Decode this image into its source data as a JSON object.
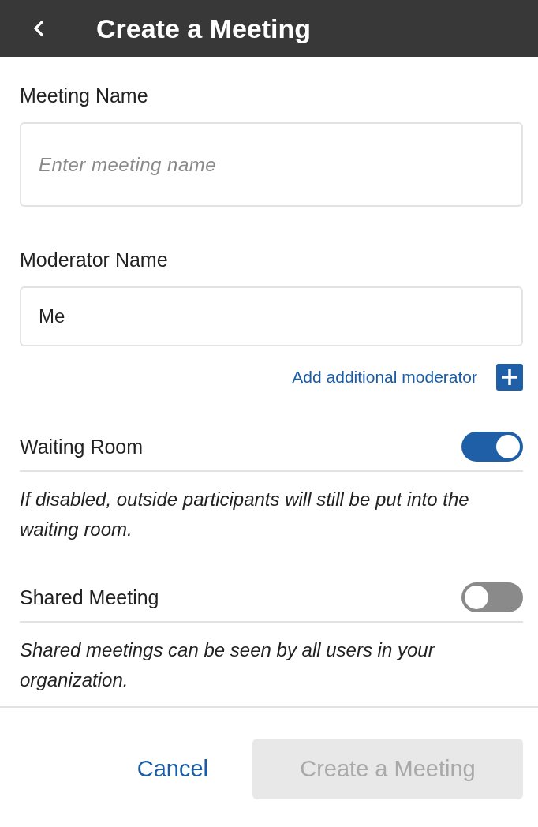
{
  "header": {
    "title": "Create a Meeting"
  },
  "fields": [
    {
      "label": "Meeting Name",
      "placeholder": "Enter meeting name"
    },
    {
      "label": "Moderator Name",
      "value": "Me"
    }
  ],
  "add_moderator": {
    "label": "Add additional moderator"
  },
  "toggles": [
    {
      "label": "Waiting Room",
      "on": true,
      "description": "If disabled, outside participants will still be put into the waiting room."
    },
    {
      "label": "Shared Meeting",
      "on": false,
      "description": "Shared meetings can be seen by all users in your organization."
    }
  ],
  "footer": {
    "cancel": "Cancel",
    "submit": {
      "label": "Create a Meeting",
      "disabled": true
    }
  }
}
